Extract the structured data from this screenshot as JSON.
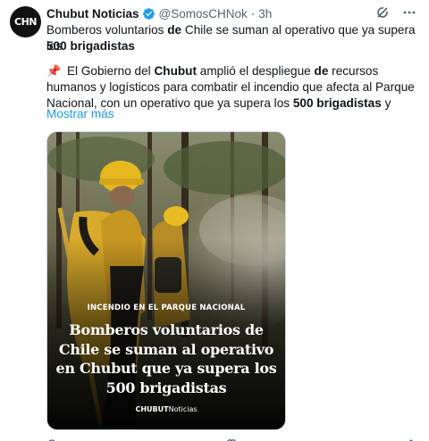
{
  "tweet": {
    "avatar_text": "CHN",
    "author_name": "Chubut Noticias",
    "handle": "@SomosCHNok",
    "separator": "·",
    "time": "3h",
    "line1_a": "Bomberos voluntarios ",
    "line1_b": "de",
    "line1_c": " Chile se suman al operativo que ya supera los",
    "line2": "500 brigadistas",
    "pin_emoji": "📌",
    "p2_a": " El Gobierno del ",
    "p2_b": "Chubut",
    "p2_c": " amplió el despliegue ",
    "p2_d": "de",
    "p2_e": " recursos humanos y logísticos para combatir el incendio que afecta al Parque Nacional, con un operativo que ya supera los ",
    "p2_f": "500 brigadistas",
    "p2_g": " y",
    "show_more": "Mostrar más"
  },
  "media": {
    "tag": "INCENDIO EN EL PARQUE NACIONAL",
    "headline": "Bomberos voluntarios de Chile se suman al operativo en Chubut que ya supera los 500 brigadistas",
    "brand_bold": "CHUBUT",
    "brand_rest": "Noticias"
  },
  "icons": {
    "verified": "verified-badge-icon",
    "grok": "grok-icon",
    "more": "more-options-icon"
  },
  "colors": {
    "accent": "#1d9bf0",
    "secondary_text": "#536471",
    "helmet": "#e8b820"
  }
}
